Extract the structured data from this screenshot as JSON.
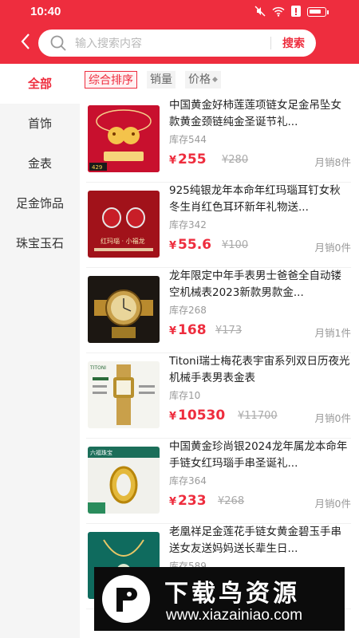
{
  "status_bar": {
    "time": "10:40"
  },
  "search": {
    "placeholder": "输入搜索内容",
    "button_label": "搜索"
  },
  "categories": [
    {
      "label": "全部"
    },
    {
      "label": "首饰"
    },
    {
      "label": "金表"
    },
    {
      "label": "足金饰品"
    },
    {
      "label": "珠宝玉石"
    }
  ],
  "sort": {
    "comprehensive": "综合排序",
    "sales": "销量",
    "price": "价格"
  },
  "products": [
    {
      "name": "中国黄金好柿莲莲项链女足金吊坠女款黄金颈链纯金圣诞节礼...",
      "stock": "库存544",
      "price": "255",
      "original": "¥280",
      "sold": "月销8件"
    },
    {
      "name": "925纯银龙年本命年红玛瑙耳钉女秋冬生肖红色耳环新年礼物送...",
      "stock": "库存342",
      "price": "55.6",
      "original": "¥100",
      "sold": "月销0件"
    },
    {
      "name": "龙年限定中年手表男士爸爸全自动镂空机械表2023新款男款金...",
      "stock": "库存268",
      "price": "168",
      "original": "¥173",
      "sold": "月销1件"
    },
    {
      "name": "Titoni瑞士梅花表宇宙系列双日历夜光机械手表男表金表",
      "stock": "库存10",
      "price": "10530",
      "original": "¥11700",
      "sold": "月销0件"
    },
    {
      "name": "中国黄金珍尚银2024龙年属龙本命年手链女红玛瑙手串圣诞礼...",
      "stock": "库存364",
      "price": "233",
      "original": "¥268",
      "sold": "月销0件"
    },
    {
      "name": "老凰祥足金莲花手链女黄金碧玉手串送女友送妈妈送长辈生日...",
      "stock": "库存589",
      "price": "",
      "original": "",
      "sold": ""
    }
  ],
  "currency": "¥",
  "thumb_tags": {
    "p1_tag": "429",
    "p2_caption": "红玛瑙 · 小福龙",
    "p4_brand": "TITONI",
    "p5_brand": "六福珠宝"
  },
  "watermark": {
    "title": "下载鸟资源",
    "url": "www.xiazainiao.com"
  },
  "accent_color": "#ee2d3e"
}
